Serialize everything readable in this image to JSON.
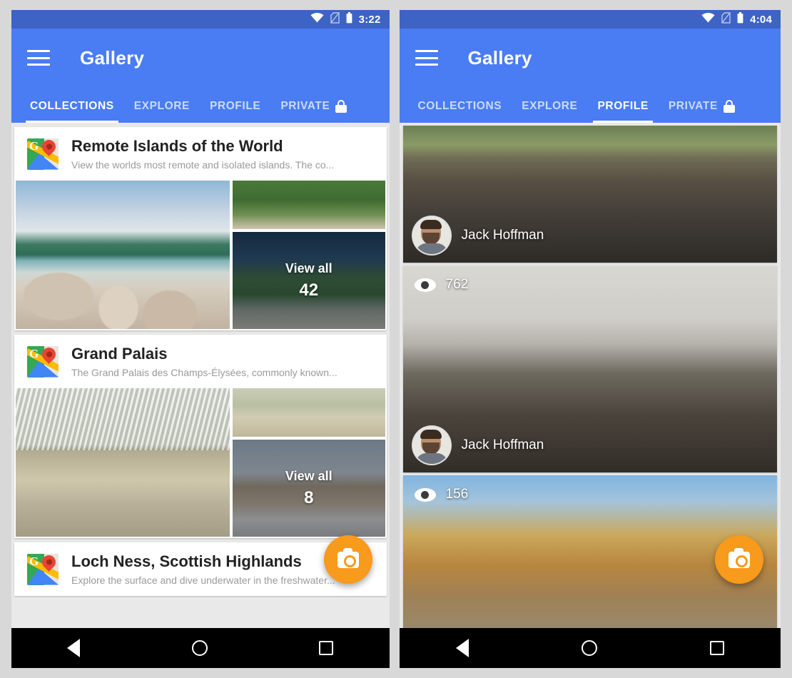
{
  "colors": {
    "status_bar": "#3d63c4",
    "app_bar": "#4a7cf3",
    "fab": "#f89a1c",
    "nav_bar": "#000000"
  },
  "left_screen": {
    "status_bar": {
      "time": "3:22",
      "wifi_icon": "wifi-icon",
      "sim_icon": "sim-off-icon",
      "battery_icon": "battery-icon"
    },
    "app_bar": {
      "menu_icon": "hamburger-menu-icon",
      "title": "Gallery"
    },
    "tabs": [
      {
        "label": "COLLECTIONS",
        "active": true,
        "icon": ""
      },
      {
        "label": "EXPLORE",
        "active": false,
        "icon": ""
      },
      {
        "label": "PROFILE",
        "active": false,
        "icon": ""
      },
      {
        "label": "PRIVATE",
        "active": false,
        "icon": "lock-icon"
      }
    ],
    "collections": [
      {
        "icon": "google-maps-icon",
        "title": "Remote Islands of the World",
        "description": "View the worlds most remote and isolated islands. The co...",
        "view_all_label": "View all",
        "view_all_count": "42"
      },
      {
        "icon": "google-maps-icon",
        "title": "Grand Palais",
        "description": "The Grand Palais des Champs-Élysées, commonly known...",
        "view_all_label": "View all",
        "view_all_count": "8"
      },
      {
        "icon": "google-maps-icon",
        "title": "Loch Ness, Scottish Highlands",
        "description": "Explore the surface and dive underwater in the freshwater...",
        "view_all_label": "",
        "view_all_count": ""
      }
    ],
    "fab": {
      "icon": "camera-icon"
    },
    "nav_bar": {
      "back": "back-triangle-icon",
      "home": "home-circle-icon",
      "recents": "recents-square-icon"
    }
  },
  "right_screen": {
    "status_bar": {
      "time": "4:04",
      "wifi_icon": "wifi-icon",
      "sim_icon": "sim-off-icon",
      "battery_icon": "battery-icon"
    },
    "app_bar": {
      "menu_icon": "hamburger-menu-icon",
      "title": "Gallery"
    },
    "tabs": [
      {
        "label": "COLLECTIONS",
        "active": false,
        "icon": ""
      },
      {
        "label": "EXPLORE",
        "active": false,
        "icon": ""
      },
      {
        "label": "PROFILE",
        "active": true,
        "icon": ""
      },
      {
        "label": "PRIVATE",
        "active": false,
        "icon": "lock-icon"
      }
    ],
    "photos": [
      {
        "author": "Jack Hoffman",
        "views": "",
        "scene": "park-path-panorama"
      },
      {
        "author": "Jack Hoffman",
        "views": "762",
        "scene": "office-cafeteria-panorama"
      },
      {
        "author": "",
        "views": "156",
        "scene": "autumn-forest-bikes-panorama"
      }
    ],
    "fab": {
      "icon": "camera-icon"
    },
    "nav_bar": {
      "back": "back-triangle-icon",
      "home": "home-circle-icon",
      "recents": "recents-square-icon"
    }
  }
}
